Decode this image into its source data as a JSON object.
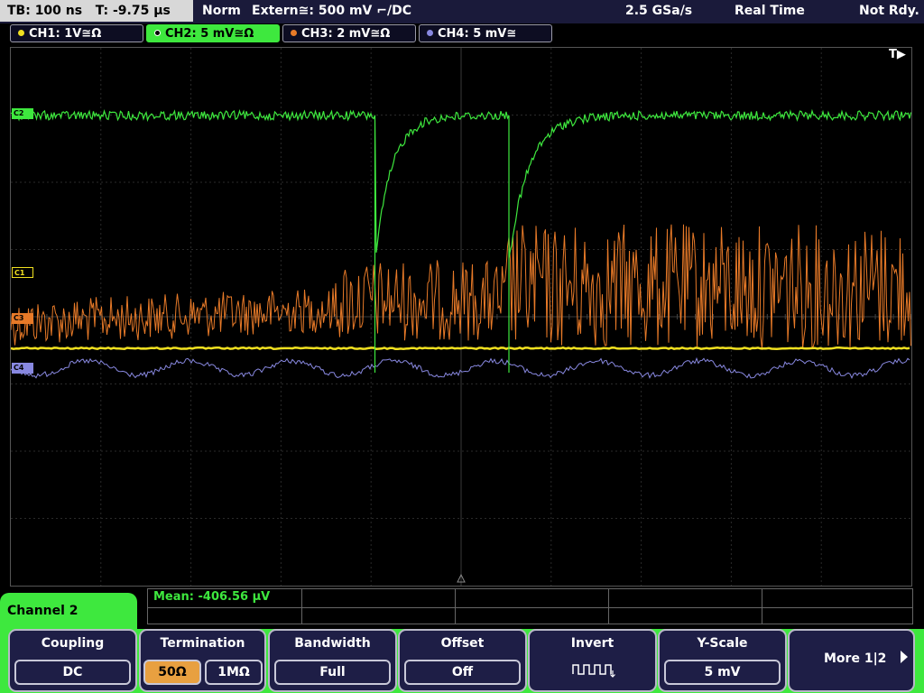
{
  "status": {
    "timebase": "TB: 100 ns",
    "trigger_time": "T: -9.75 µs",
    "trigger_mode": "Norm",
    "trigger_source": "Extern≅: 500 mV ⌐/DC",
    "sample_rate": "2.5 GSa/s",
    "acq_mode": "Real Time",
    "trigger_state": "Not Rdy."
  },
  "channels": [
    {
      "label": "CH1: 1V≅Ω",
      "color": "#f0e020"
    },
    {
      "label": "CH2: 5 mV≅Ω",
      "color": "#3ee83e"
    },
    {
      "label": "CH3: 2 mV≅Ω",
      "color": "#e87a28"
    },
    {
      "label": "CH4: 5 mV≅",
      "color": "#8888e0"
    }
  ],
  "markers": {
    "c1": "C1",
    "c2": "C2",
    "c3": "C3",
    "c4": "C4",
    "trigger": "T▶"
  },
  "measurement": {
    "text": "Mean: -406.56 µV"
  },
  "menu": {
    "title": "Channel 2",
    "softkeys": [
      {
        "label": "Coupling",
        "value": "DC"
      },
      {
        "label": "Termination",
        "opt1": "50Ω",
        "opt2": "1MΩ"
      },
      {
        "label": "Bandwidth",
        "value": "Full"
      },
      {
        "label": "Offset",
        "value": "Off"
      },
      {
        "label": "Invert"
      },
      {
        "label": "Y-Scale",
        "value": "5 mV"
      },
      {
        "label": "More 1|2"
      }
    ]
  },
  "colors": {
    "ch1": "#f0e020",
    "ch2": "#3ee83e",
    "ch3": "#e87a28",
    "ch4": "#8888e0",
    "menu_accent": "#3ee83e"
  }
}
